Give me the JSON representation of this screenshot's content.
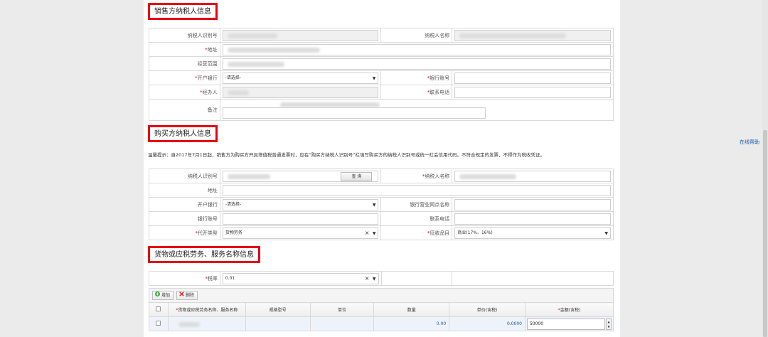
{
  "seller": {
    "title": "销售方纳税人信息",
    "taxpayer_id_label": "纳税人识别号",
    "taxpayer_name_label": "纳税人名称",
    "address_label": "地址",
    "business_scope_label": "经营范围",
    "bank_label": "开户银行",
    "bank_placeholder": "-请选择-",
    "bank_account_label": "银行账号",
    "operator_label": "经办人",
    "phone_label": "联系电话",
    "remark_label": "备注",
    "required_mark": "*"
  },
  "buyer": {
    "title": "购买方纳税人信息",
    "notice": "温馨提示：自2017年7月1日起，销售方为购买方开具增值税普通发票时，应在“购买方纳税人识别号”栏填写购买方的纳税人识别号或统一社会信用代码。不符合规定的发票，不得作为税收凭证。",
    "taxpayer_id_label": "纳税人识别号",
    "query_button": "查 询",
    "taxpayer_name_label": "纳税人名称",
    "address_label": "地址",
    "bank_label": "开户银行",
    "bank_placeholder": "-请选择-",
    "bank_branch_label": "银行营业网点名称",
    "bank_account_label": "银行账号",
    "phone_label": "联系电话",
    "agent_type_label": "代开类型",
    "agent_type_value": "货物劳务",
    "tax_item_label": "征收品目",
    "tax_item_value": "商业(17%、16%)",
    "required_mark": "*"
  },
  "goods": {
    "title": "货物或应税劳务、服务名称信息",
    "tax_rate_label": "税率",
    "tax_rate_value": "0.01",
    "required_mark": "*",
    "add_button": "增加",
    "delete_button": "删除",
    "columns": [
      "货物或应税劳务名称、服务名称",
      "规格型号",
      "单位",
      "数量",
      "单价(含税)",
      "金额(含税)"
    ],
    "rows": [
      {
        "quantity": "0.00",
        "unit_price": "0.0000",
        "amount": "50000"
      }
    ]
  },
  "sidebar": {
    "help_link": "在线帮助"
  },
  "colors": {
    "highlight_border": "#e60012",
    "required": "#e60012",
    "link": "#1a5aa8"
  }
}
